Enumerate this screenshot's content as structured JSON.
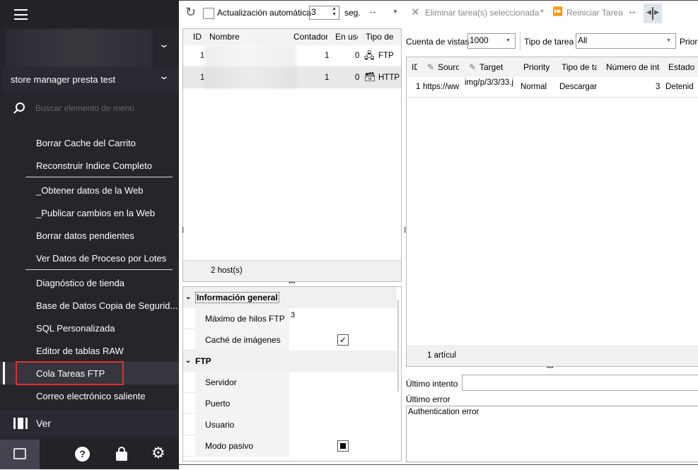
{
  "sidebar": {
    "store_name": "store manager presta test",
    "search_placeholder": "Buscar elemento de menú",
    "items": [
      "Borrar Cache del Carrito",
      "Reconstruir Indice Completo",
      "_Obtener datos de la Web",
      "_Publicar cambios en la Web",
      "Borrar datos pendientes",
      "Ver Datos de Proceso por Lotes",
      "Diagnóstico de tienda",
      "Base de Datos Copia de Segurid...",
      "SQL Personalizada",
      "Editor de tablas RAW",
      "Cola Tareas FTP",
      "Correo electrónico saliente"
    ],
    "selected_item": "Cola Tareas FTP",
    "ver_label": "Ver",
    "highlight_color": "#e03030"
  },
  "toolbar": {
    "auto_update_label": "Actualización automática",
    "interval_value": "3",
    "seconds_label": "seg.",
    "delete_label": "Eliminar tarea(s) seleccionada",
    "restart_label": "Reiniciar Tarea"
  },
  "hosts": {
    "columns": [
      "ID",
      "Nombre",
      "Contador",
      "En uso",
      "Tipo de"
    ],
    "rows": [
      {
        "id": "1",
        "counter": "1",
        "in_use": "0",
        "type": "FTP"
      },
      {
        "id": "1",
        "counter": "1",
        "in_use": "0",
        "type": "HTTP"
      }
    ],
    "footer": "2 host(s)"
  },
  "properties": {
    "general_title": "Información general",
    "max_threads_label": "Máximo de hilos FTP",
    "max_threads_value": "3",
    "image_cache_label": "Caché de imágenes",
    "image_cache_checked": true,
    "ftp_title": "FTP",
    "server_label": "Servidor",
    "port_label": "Puerto",
    "user_label": "Usuario",
    "passive_label": "Modo pasivo",
    "passive_state": "indeterminate"
  },
  "tasks": {
    "view_count_label": "Cuenta de vistas",
    "view_count_value": "1000",
    "task_type_label": "Tipo de tarea",
    "task_type_value": "All",
    "priority_label": "Prior",
    "columns": [
      "ID",
      "Source",
      "Target",
      "Priority",
      "Tipo de ta",
      "Número de int",
      "Estado"
    ],
    "rows": [
      {
        "id": "1",
        "source": "https://ww",
        "target": "img/p/3/3/33.j",
        "priority": "Normal",
        "type": "Descargar",
        "attempts": "3",
        "status": "Detenid"
      }
    ],
    "footer": "1 artícul",
    "last_attempt_label": "Último intento",
    "last_attempt_value": "",
    "last_error_label": "Último error",
    "last_error_value": "Authentication error"
  }
}
